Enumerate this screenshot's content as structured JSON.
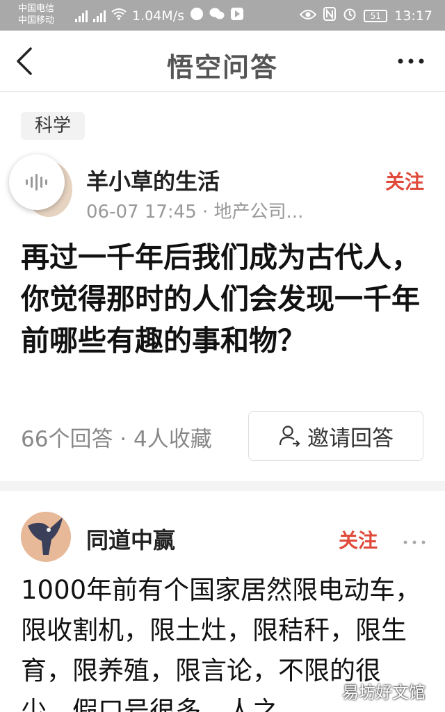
{
  "status_bar": {
    "carrier1": "中国电信",
    "carrier2": "中国移动",
    "speed": "1.04M/s",
    "time": "13:17",
    "battery": "51"
  },
  "nav": {
    "title": "悟空问答"
  },
  "question": {
    "tag": "科学",
    "author": "羊小草的生活",
    "meta": "06-07 17:45 · 地产公司...",
    "follow_label": "关注",
    "title": "再过一千年后我们成为古代人，你觉得那时的人们会发现一千年前哪些有趣的事和物？",
    "stats": "66个回答 · 4人收藏",
    "invite_label": "邀请回答"
  },
  "answer": {
    "author": "同道中赢",
    "follow_label": "关注",
    "text": "1000年前有个国家居然限电动车，限收割机，限土灶，限秸秆，限生育，限养殖，限言论，不限的很少，假口号很多，人之"
  },
  "watermark": "易坊好文馆",
  "colors": {
    "accent": "#e04a3a",
    "statusbar": "#a9a9a9"
  }
}
